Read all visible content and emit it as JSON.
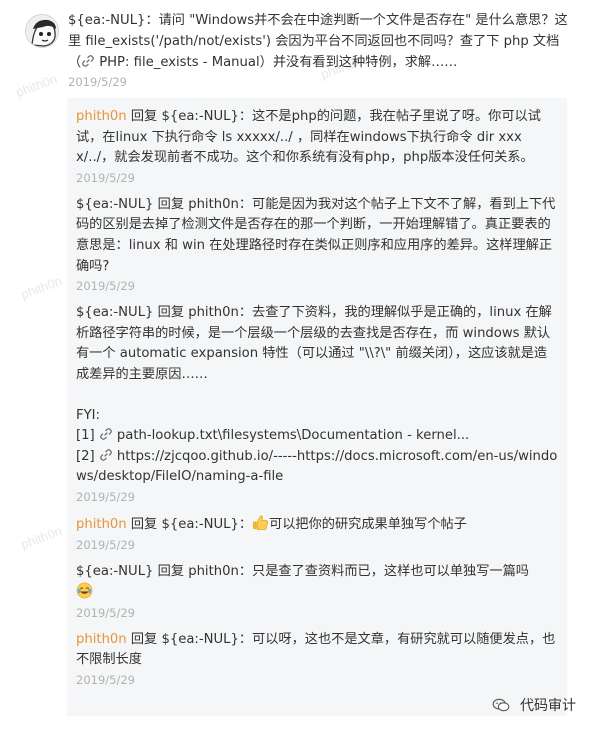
{
  "main": {
    "author": "${ea:-NUL}",
    "text_before_link": "：请问 \"Windows并不会在中途判断一个文件是否存在\" 是什么意思？这里 file_exists('/path/not/exists') 会因为平台不同返回也不同吗？查了下 php 文档（",
    "link_text": "PHP: file_exists - Manual",
    "text_after_link": "）并没有看到这种特例，求解……",
    "date": "2019/5/29",
    "avatar_icon": "cartoon-avatar"
  },
  "replies": [
    {
      "from": "phith0n",
      "from_color": "#e8943a",
      "action": " 回复 ",
      "to": "${ea:-NUL}",
      "text": "：这不是php的问题，我在帖子里说了呀。你可以试试，在linux 下执行命令 ls xxxxx/../ ，同样在windows下执行命令 dir xxxx/../，就会发现前者不成功。这个和你系统有没有php，php版本没任何关系。",
      "date": "2019/5/29"
    },
    {
      "from": "${ea:-NUL}",
      "from_color": "#333333",
      "action": " 回复 ",
      "to": "phith0n",
      "text": "：可能是因为我对这个帖子上下文不了解，看到上下代码的区别是去掉了检测文件是否存在的那一个判断，一开始理解错了。真正要表的意思是：linux 和 win 在处理路径时存在类似正则序和应用序的差异。这样理解正确吗?",
      "date": "2019/5/29"
    },
    {
      "from": "${ea:-NUL}",
      "from_color": "#333333",
      "action": " 回复 ",
      "to": "phith0n",
      "text": "：去查了下资料，我的理解似乎是正确的，linux 在解析路径字符串的时候，是一个层级一个层级的去查找是否存在，而 windows 默认有一个 automatic expansion 特性（可以通过 \"\\\\?\\\" 前缀关闭），这应该就是造成差异的主要原因……",
      "fyi_label": "FYI:",
      "refs": [
        {
          "num": "[1] ",
          "text": "path-lookup.txt\\filesystems\\Documentation - kernel..."
        },
        {
          "num": "[2] ",
          "text": "https://zjcqoo.github.io/-----https://docs.microsoft.com/en-us/windows/desktop/FileIO/naming-a-file"
        }
      ],
      "date": "2019/5/29"
    },
    {
      "from": "phith0n",
      "from_color": "#e8943a",
      "action": " 回复 ",
      "to": "${ea:-NUL}",
      "text": "可以把你的研究成果单独写个帖子",
      "emoji": "thumbs-up",
      "date": "2019/5/29"
    },
    {
      "from": "${ea:-NUL}",
      "from_color": "#333333",
      "action": " 回复 ",
      "to": "phith0n",
      "text": "：只是查了查资料而已，这样也可以单独写一篇吗",
      "emoji": "tears-of-joy",
      "date": "2019/5/29"
    },
    {
      "from": "phith0n",
      "from_color": "#e8943a",
      "action": " 回复 ",
      "to": "${ea:-NUL}",
      "text": "：可以呀，这也不是文章，有研究就可以随便发点，也不限制长度",
      "date": "2019/5/29"
    }
  ],
  "watermark": {
    "text": "代码审计",
    "icon": "wechat-logo-icon"
  },
  "bg_watermark": "phith0n"
}
